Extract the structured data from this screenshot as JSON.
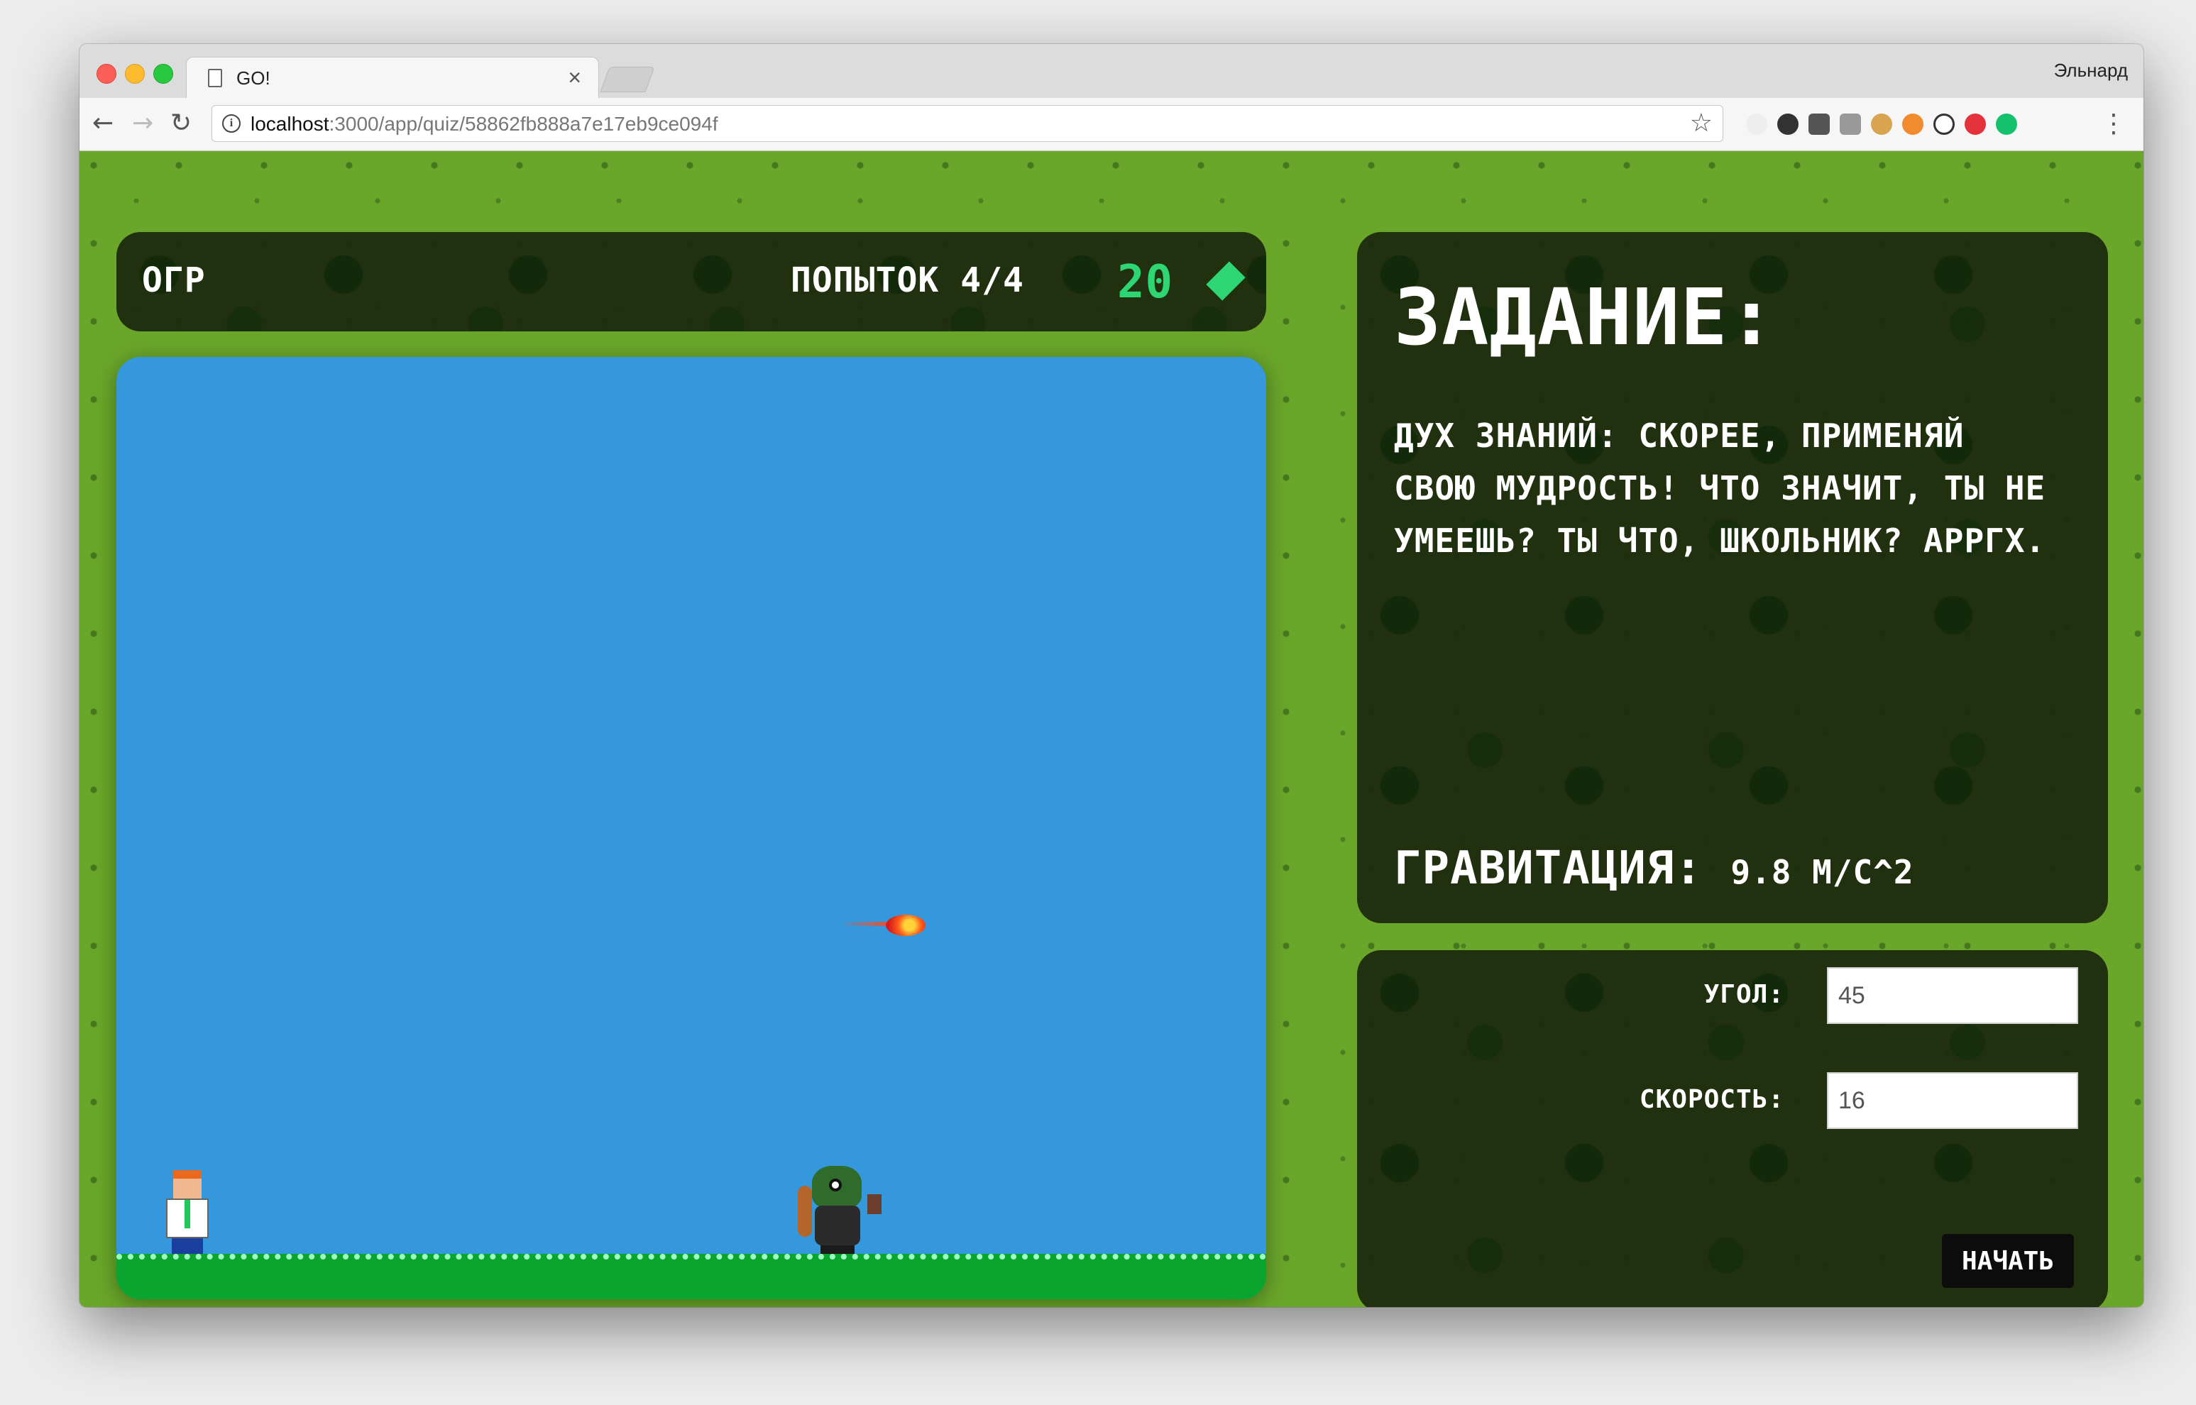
{
  "browser": {
    "tab_title": "GO!",
    "tab_close": "×",
    "profile_name": "Эльнард",
    "url_host": "localhost",
    "url_path": ":3000/app/quiz/58862fb888a7e17eb9ce094f",
    "back": "←",
    "forward": "→",
    "reload": "↻",
    "star": "☆",
    "menu": "⋮",
    "info": "i"
  },
  "hud": {
    "level_name": "ОГР",
    "attempts": "ПОПЫТОК 4/4",
    "gems": "20",
    "gem_color": "#2ed573"
  },
  "task": {
    "heading": "ЗАДАНИЕ:",
    "text": "ДУХ ЗНАНИЙ: СКОРЕЕ, ПРИМЕНЯЙ СВОЮ МУДРОСТЬ! ЧТО ЗНАЧИТ, ТЫ НЕ УМЕЕШЬ? ТЫ ЧТО, ШКОЛЬНИК? АРРГХ.",
    "gravity_label": "ГРАВИТАЦИЯ:",
    "gravity_value": "9.8 М/С^2"
  },
  "controls": {
    "angle_label": "УГОЛ:",
    "angle_value": "45",
    "speed_label": "СКОРОСТЬ:",
    "speed_value": "16",
    "start_label": "НАЧАТЬ"
  },
  "colors": {
    "sky": "#3597dc",
    "ground": "#0aa52f",
    "grass": "#6aa62a",
    "panel": "#1c280e"
  }
}
